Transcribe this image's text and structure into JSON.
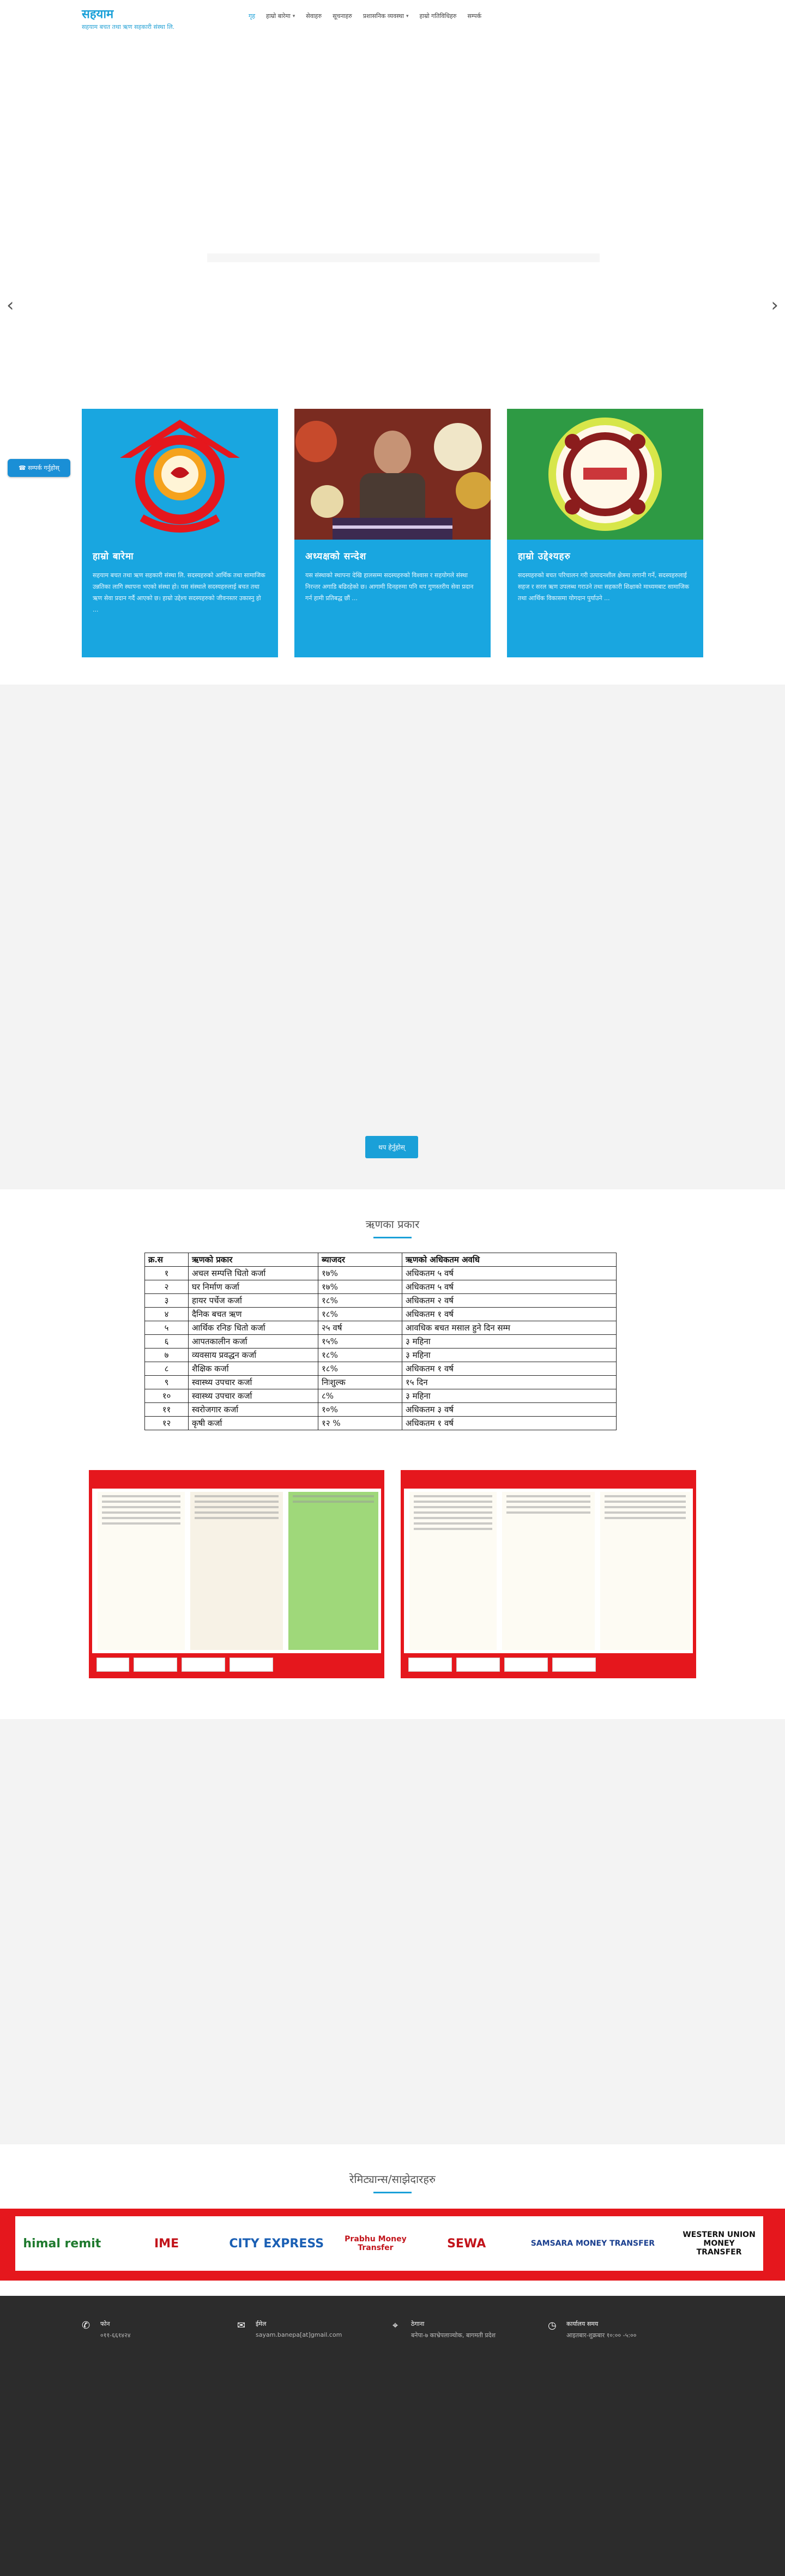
{
  "header": {
    "title": "सहयाम",
    "tagline": "सहयाम बचत तथा ऋण सहकारी संस्था लि.",
    "nav": [
      {
        "label": "गृह",
        "active": true,
        "dropdown": false
      },
      {
        "label": "हाम्रो बारेमा",
        "active": false,
        "dropdown": true
      },
      {
        "label": "सेवाहरु",
        "active": false,
        "dropdown": false
      },
      {
        "label": "सूचनाहरु",
        "active": false,
        "dropdown": false
      },
      {
        "label": "प्रशासनिक व्यवस्था",
        "active": false,
        "dropdown": true
      },
      {
        "label": "हाम्रो गतिविधिहरु",
        "active": false,
        "dropdown": false
      },
      {
        "label": "सम्पर्क",
        "active": false,
        "dropdown": false
      }
    ]
  },
  "hero": {
    "prev_icon": "chevron-left-icon",
    "next_icon": "chevron-right-icon"
  },
  "contact_button": {
    "label": "☎ सम्पर्क गर्नुहोस्",
    "icon": "phone-icon"
  },
  "cards": [
    {
      "title": "हाम्रो बारेमा",
      "text": "सहयाम बचत तथा ऋण सहकारी संस्था लि. सदस्यहरुको आर्थिक तथा सामाजिक उन्नतिका लागि स्थापना भएको संस्था हो। यस संस्थाले सदस्यहरुलाई बचत तथा ऋण सेवा प्रदान गर्दै आएको छ। हाम्रो उद्देश्य सदस्यहरुको जीवनस्तर उकास्नु हो ..."
    },
    {
      "title": "अध्यक्षको सन्देश",
      "text": "यस संस्थाको स्थापना देखि हालसम्म सदस्यहरुको विश्वास र सहयोगले संस्था निरन्तर अगाडि बढिरहेको छ। आगामी दिनहरुमा पनि थप गुणस्तरीय सेवा प्रदान गर्न हामी प्रतिबद्ध छौं ..."
    },
    {
      "title": "हाम्रो उद्देश्यहरु",
      "text": "सदस्यहरुको बचत परिचालन गरी उत्पादनशील क्षेत्रमा लगानी गर्ने, सदस्यहरुलाई सहज र सरल ऋण उपलब्ध गराउने तथा सहकारी शिक्षाको माध्यमबाट सामाजिक तथा आर्थिक विकासमा योगदान पुर्याउने ..."
    }
  ],
  "more_button": "थप हेर्नुहोस्",
  "loan_section": {
    "title": "ऋणका प्रकार",
    "headers": [
      "क्र.स",
      "ऋणको प्रकार",
      "ब्याजदर",
      "ऋणको अधिकतम अवधि"
    ],
    "rows": [
      [
        "१",
        "अचल सम्पत्ति धितो कर्जा",
        "१७%",
        "अधिकतम ५ वर्ष"
      ],
      [
        "२",
        "घर निर्माण कर्जा",
        "१७%",
        "अधिकतम ५ वर्ष"
      ],
      [
        "३",
        "हायर पर्चेज कर्जा",
        "१८%",
        "अधिकतम २ वर्ष"
      ],
      [
        "४",
        "दैनिक बचत ऋण",
        "१८%",
        "अधिकतम १ वर्ष"
      ],
      [
        "५",
        "आर्थिक रनिङ धितो कर्जा",
        "२५ वर्ष",
        "आवधिक बचत मसाल हुने दिन सम्म"
      ],
      [
        "६",
        "आपतकालीन कर्जा",
        "१५%",
        "३ महिना"
      ],
      [
        "७",
        "व्यवसाय प्रवद्धन कर्जा",
        "१८%",
        "३ महिना"
      ],
      [
        "८",
        "शैक्षिक कर्जा",
        "१८%",
        "अधिकतम १ वर्ष"
      ],
      [
        "९",
        "स्वास्थ्य उपचार कर्जा",
        "निःशुल्क",
        "१५ दिन"
      ],
      [
        "१०",
        "स्वास्थ्य उपचार कर्जा",
        "८%",
        "३ महिना"
      ],
      [
        "११",
        "स्वरोजगार कर्जा",
        "१०%",
        "अधिकतम ३ वर्ष"
      ],
      [
        "१२",
        "कृषी कर्जा",
        "१२ %",
        "अधिकतम १ वर्ष"
      ]
    ]
  },
  "partners": {
    "title": "रेमिट्यान्स/साझेदारहरु",
    "logos": [
      {
        "text": "himal remit",
        "color": "#1f7a2e"
      },
      {
        "text": "IME",
        "color": "#c2141b"
      },
      {
        "text": "CITY EXPRESS",
        "color": "#1a5fb4"
      },
      {
        "text": "Prabhu Money Transfer",
        "color": "#c2141b"
      },
      {
        "text": "SEWA",
        "color": "#c2141b"
      },
      {
        "text": "SAMSARA MONEY TRANSFER",
        "color": "#1a3f8f"
      },
      {
        "text": "WESTERN UNION MONEY TRANSFER",
        "color": "#111"
      }
    ]
  },
  "footer": {
    "items": [
      {
        "icon": "phone-icon",
        "glyph": "✆",
        "label": "फोन",
        "value": "०११-६६१४२४"
      },
      {
        "icon": "mail-icon",
        "glyph": "✉",
        "label": "ईमेल",
        "value": "sayam.banepa[at]gmail.com"
      },
      {
        "icon": "location-icon",
        "glyph": "⌖",
        "label": "ठेगाना",
        "value": "बनेपा-७ काभ्रेपलाञ्चोक, बागमती प्रदेश"
      },
      {
        "icon": "clock-icon",
        "glyph": "◷",
        "label": "कार्यालय समय",
        "value": "आइतबार-शुक्रबार १०:०० -५:००"
      }
    ]
  }
}
